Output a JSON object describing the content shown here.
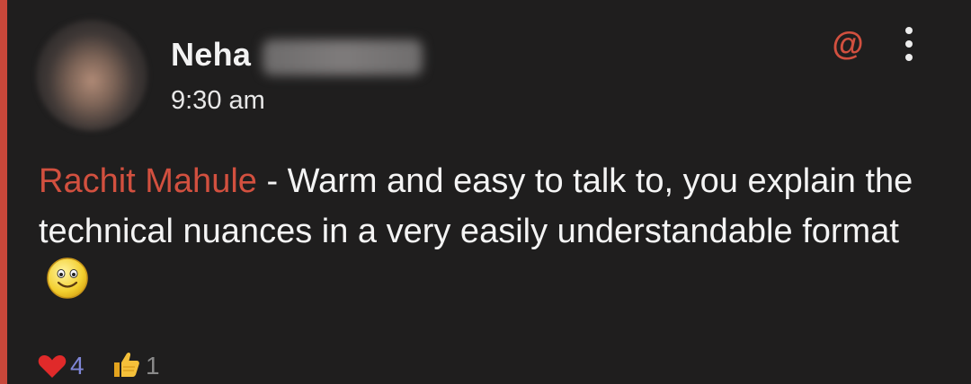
{
  "post": {
    "author_name": "Neha",
    "time": "9:30 am",
    "mention_symbol": "@",
    "comment_mention": "Rachit Mahule",
    "comment_text": " - Warm and easy to talk to, you explain the technical nuances in a very easily understandable format"
  },
  "reactions": {
    "hearts_count": "4",
    "likes_count": "1"
  },
  "icons": {
    "avatar": "profile-photo-blurred",
    "surname": "blurred-text",
    "mention": "at-sign-icon",
    "menu": "more-vertical-icon",
    "emoji": "smiley-emoji",
    "heart": "heart-icon",
    "like": "thumbs-up-icon"
  },
  "colors": {
    "background": "#1f1e1e",
    "accent": "#c8473a",
    "mention_text": "#d2503f",
    "heart_count": "#7f86d6"
  }
}
